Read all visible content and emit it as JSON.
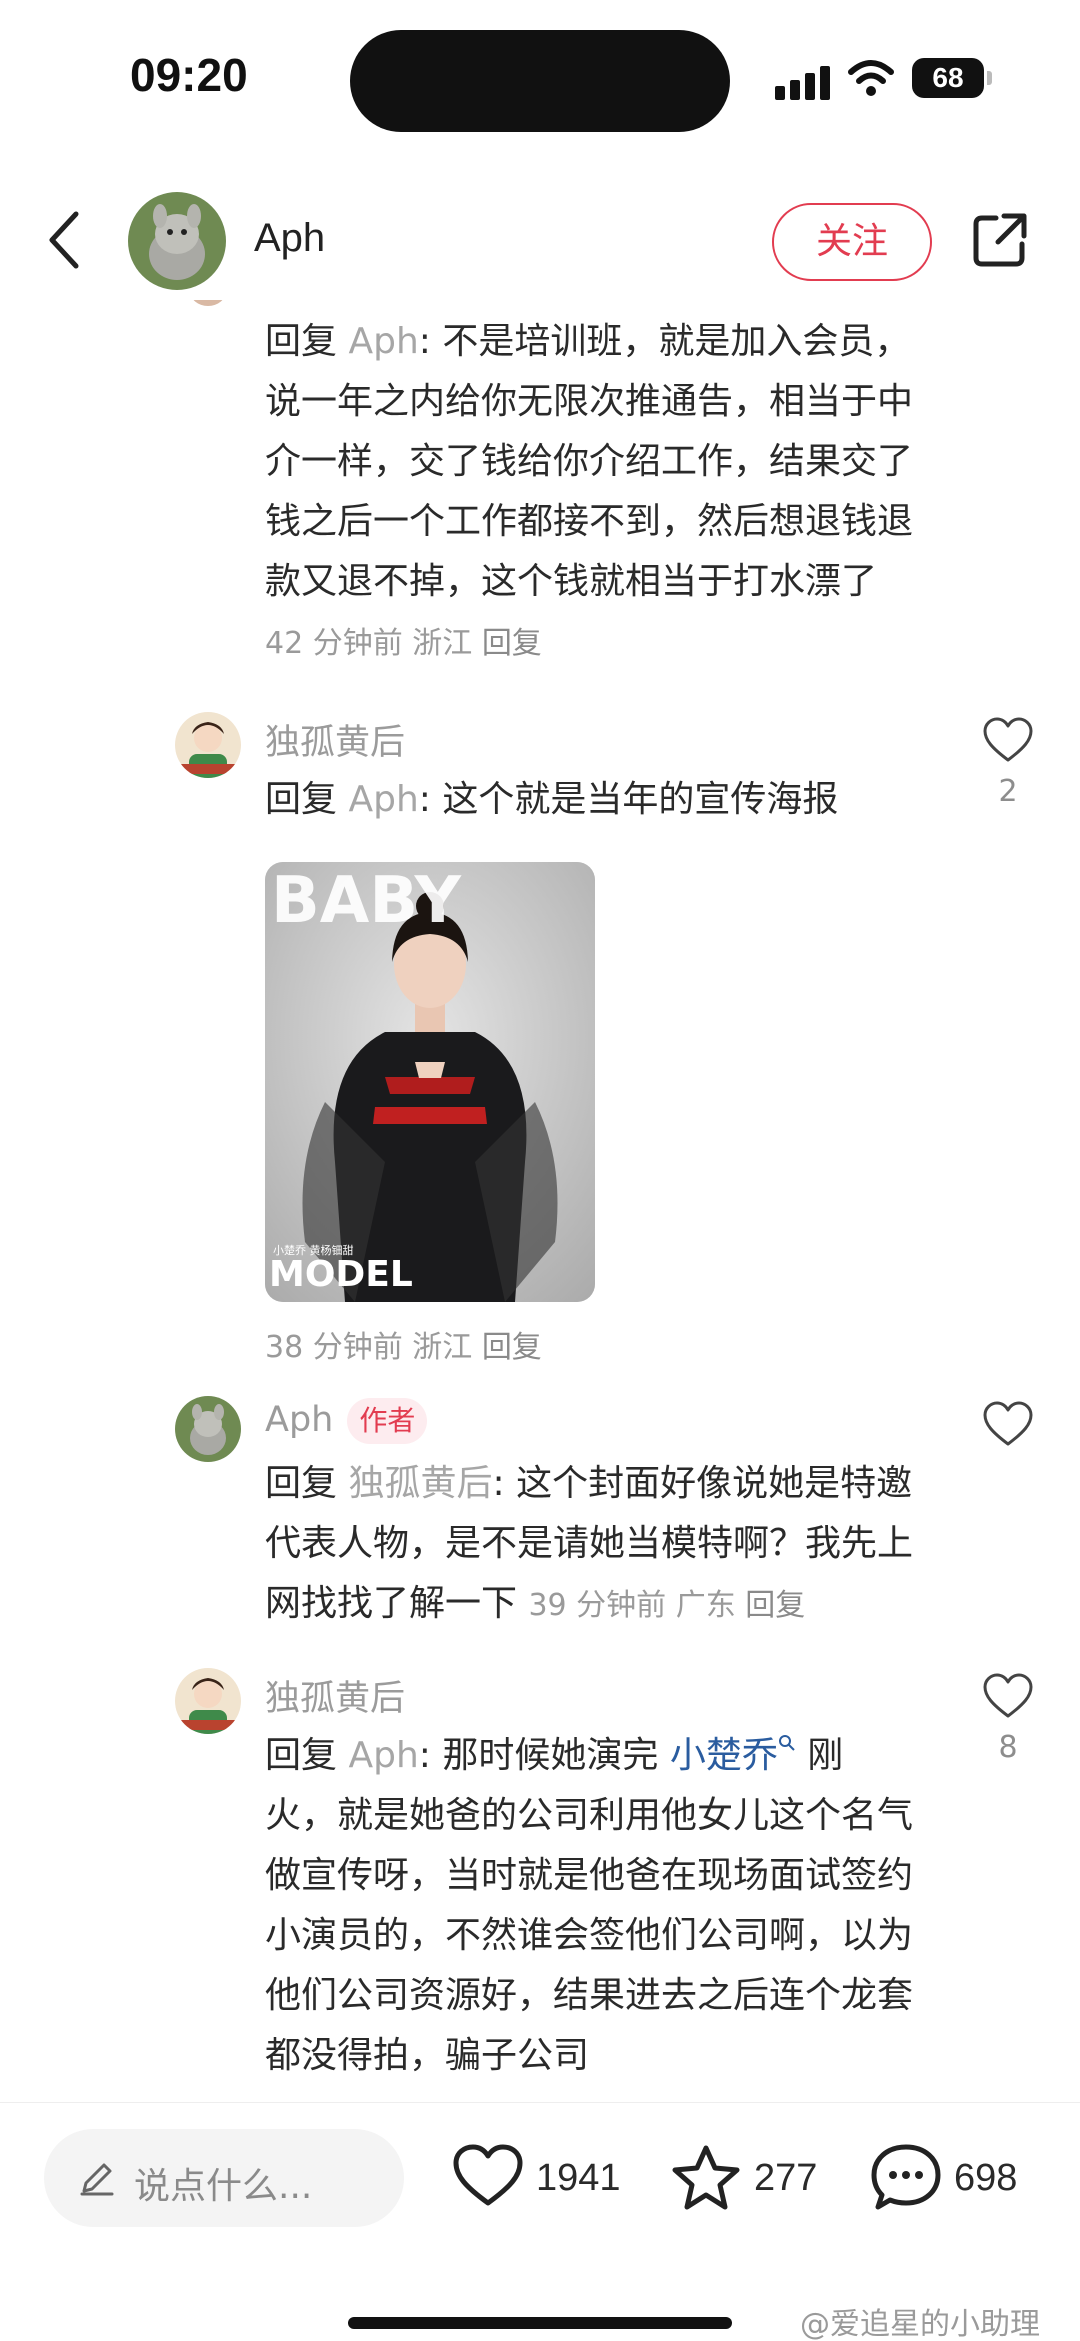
{
  "status_bar": {
    "time": "09:20",
    "battery": "68"
  },
  "header": {
    "username": "Aph",
    "follow_label": "关注"
  },
  "comments": [
    {
      "reply_prefix": "回复",
      "reply_to": "Aph",
      "text": "不是培训班，就是加入会员，说一年之内给你无限次推通告，相当于中介一样，交了钱给你介绍工作，结果交了钱之后一个工作都接不到，然后想退钱退款又退不掉，这个钱就相当于打水漂了",
      "time": "42 分钟前",
      "location": "浙江",
      "reply_label": "回复"
    },
    {
      "name": "独孤黄后",
      "reply_prefix": "回复",
      "reply_to": "Aph",
      "text": "这个就是当年的宣传海报",
      "likes": "2",
      "image": {
        "top_text": "BABY",
        "bottom_text": "MODEL",
        "caption": "小楚乔 黄杨钿甜"
      },
      "time": "38 分钟前",
      "location": "浙江",
      "reply_label": "回复"
    },
    {
      "name": "Aph",
      "author_tag": "作者",
      "reply_prefix": "回复",
      "reply_to": "独孤黄后",
      "text": "这个封面好像说她是特邀代表人物，是不是请她当模特啊？我先上网找找了解一下",
      "time": "39 分钟前",
      "location": "广东",
      "reply_label": "回复"
    },
    {
      "name": "独孤黄后",
      "reply_prefix": "回复",
      "reply_to": "Aph",
      "text_before_link": "那时候她演完",
      "link": "小楚乔",
      "text_after_link": "刚火，就是她爸的公司利用他女儿这个名气做宣传呀，当时就是他爸在现场面试签约小演员的，不然谁会签他们公司啊，以为他们公司资源好，结果进去之后连个龙套都没得拍，骗子公司",
      "likes": "8"
    }
  ],
  "bottom_bar": {
    "input_placeholder": "说点什么...",
    "likes": "1941",
    "favorites": "277",
    "comments": "698"
  },
  "watermark": "@爱追星的小助理",
  "colors": {
    "accent": "#e23c50",
    "link": "#2a5c9f",
    "muted": "#9b9b9b"
  }
}
